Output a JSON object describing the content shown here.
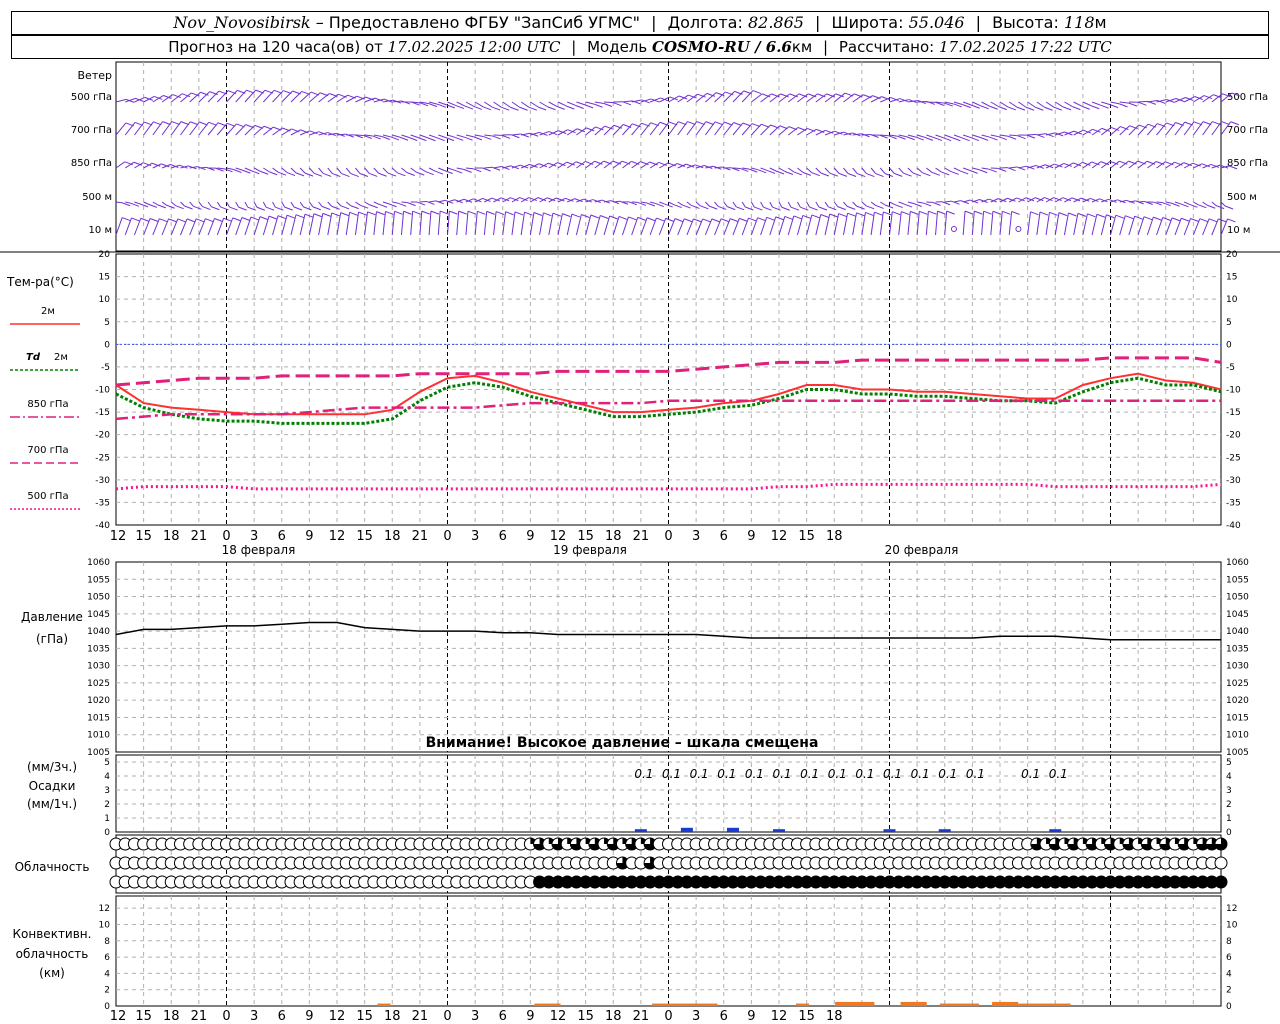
{
  "header": {
    "station": "Nov_Novosibirsk",
    "provider": "– Предоставлено ФГБУ \"ЗапСиб УГМС\"",
    "lon_label": "Долгота:",
    "lon": "82.865",
    "lat_label": "Широта:",
    "lat": "55.046",
    "alt_label": "Высота:",
    "alt": "118",
    "alt_unit": "м",
    "forecast_label": "Прогноз на 120 часа(ов) от",
    "forecast_from": "17.02.2025 12:00 UTC",
    "model_label": "Модель",
    "model": "COSMO-RU / 6.6",
    "model_unit": "км",
    "calc_label": "Рассчитано:",
    "calc_time": "17.02.2025 17:22 UTC"
  },
  "colors": {
    "wind": "#7030d0",
    "t2m": "#ff3030",
    "td2m": "#008000",
    "t850": "#e0207a",
    "t700": "#e0207a",
    "t500": "#ff1090",
    "zero_line": "#3050ff",
    "precip": "#1a3ad0",
    "convective": "#f07820",
    "grid": "#b0b0b0"
  },
  "chart_data": [
    {
      "type": "wind_barbs",
      "title": "Ветер",
      "levels": [
        "500 гПа",
        "700 гПа",
        "850 гПа",
        "500 м",
        "10 м"
      ],
      "note": "wind barbs every hour at five levels"
    },
    {
      "type": "line",
      "title": "Тем-ра(°C)",
      "ylim": [
        -40,
        20
      ],
      "yticks": [
        20,
        15,
        10,
        5,
        0,
        -5,
        -10,
        -15,
        -20,
        -25,
        -30,
        -35,
        -40
      ],
      "x_ticks": [
        "12",
        "15",
        "18",
        "21",
        "0",
        "3",
        "6",
        "9",
        "12",
        "15",
        "18",
        "21",
        "0",
        "3",
        "6",
        "9",
        "12",
        "15",
        "18",
        "21",
        "0",
        "3",
        "6",
        "9",
        "12",
        "15",
        "18"
      ],
      "day_labels": [
        "18 февраля",
        "19 февраля",
        "20 февраля"
      ],
      "legend": [
        "2м",
        "Td 2м",
        "850 гПа",
        "700 гПа",
        "500 гПа"
      ],
      "legend_td": "Td",
      "legend_td_level": "2м",
      "x_hours": [
        0,
        3,
        6,
        9,
        12,
        15,
        18,
        21,
        24,
        27,
        30,
        33,
        36,
        39,
        42,
        45,
        48,
        51,
        54,
        57,
        60,
        63,
        66,
        69,
        72,
        75,
        78,
        81,
        84,
        87,
        90,
        93,
        96,
        99,
        102,
        105,
        108,
        111,
        114,
        117,
        120
      ],
      "series": [
        {
          "name": "2м",
          "values": [
            -9,
            -13,
            -14,
            -14.5,
            -15,
            -15.5,
            -15.5,
            -15.5,
            -15.5,
            -15.5,
            -14.5,
            -10.5,
            -7.5,
            -7,
            -8.5,
            -10.5,
            -12,
            -13.5,
            -15,
            -15,
            -14.5,
            -14,
            -13,
            -12.5,
            -11,
            -9,
            -9,
            -10,
            -10,
            -10.5,
            -10.5,
            -11,
            -11.5,
            -12,
            -12,
            -9,
            -7.5,
            -6.5,
            -8,
            -8.5,
            -10
          ]
        },
        {
          "name": "Td 2м",
          "values": [
            -11,
            -14,
            -15.5,
            -16.5,
            -17,
            -17,
            -17.5,
            -17.5,
            -17.5,
            -17.5,
            -16.5,
            -12.5,
            -9.5,
            -8.5,
            -9.5,
            -11.5,
            -13,
            -14.5,
            -16,
            -16,
            -15.5,
            -15,
            -14,
            -13.5,
            -12,
            -10,
            -10,
            -11,
            -11,
            -11.5,
            -11.5,
            -12,
            -12.5,
            -12.5,
            -13,
            -10.5,
            -8.5,
            -7.5,
            -9,
            -9,
            -10.5
          ]
        },
        {
          "name": "850 гПа",
          "values": [
            -16.5,
            -16,
            -15.5,
            -15.5,
            -15.5,
            -15.5,
            -15.5,
            -15,
            -14.5,
            -14,
            -14,
            -14,
            -14,
            -14,
            -13.5,
            -13,
            -13,
            -13,
            -13,
            -13,
            -12.5,
            -12.5,
            -12.5,
            -12.5,
            -12.5,
            -12.5,
            -12.5,
            -12.5,
            -12.5,
            -12.5,
            -12.5,
            -12.5,
            -12.5,
            -12.5,
            -12.5,
            -12.5,
            -12.5,
            -12.5,
            -12.5,
            -12.5,
            -12.5
          ]
        },
        {
          "name": "700 гПа",
          "values": [
            -9,
            -8.5,
            -8,
            -7.5,
            -7.5,
            -7.5,
            -7,
            -7,
            -7,
            -7,
            -7,
            -6.5,
            -6.5,
            -6.5,
            -6.5,
            -6.5,
            -6,
            -6,
            -6,
            -6,
            -6,
            -5.5,
            -5,
            -4.5,
            -4,
            -4,
            -4,
            -3.5,
            -3.5,
            -3.5,
            -3.5,
            -3.5,
            -3.5,
            -3.5,
            -3.5,
            -3.5,
            -3,
            -3,
            -3,
            -3,
            -4
          ]
        },
        {
          "name": "500 гПа",
          "values": [
            -32,
            -31.5,
            -31.5,
            -31.5,
            -31.5,
            -32,
            -32,
            -32,
            -32,
            -32,
            -32,
            -32,
            -32,
            -32,
            -32,
            -32,
            -32,
            -32,
            -32,
            -32,
            -32,
            -32,
            -32,
            -32,
            -31.5,
            -31.5,
            -31,
            -31,
            -31,
            -31,
            -31,
            -31,
            -31,
            -31,
            -31.5,
            -31.5,
            -31.5,
            -31.5,
            -31.5,
            -31.5,
            -31
          ]
        }
      ]
    },
    {
      "type": "line",
      "title": "Давление",
      "units": "(гПа)",
      "ylim": [
        1005,
        1060
      ],
      "yticks": [
        1060,
        1055,
        1050,
        1045,
        1040,
        1035,
        1030,
        1025,
        1020,
        1015,
        1010,
        1005
      ],
      "note_text": "Внимание! Высокое давление – шкала смещена",
      "series": [
        {
          "name": "Давление",
          "values": [
            1039,
            1040.5,
            1040.5,
            1041,
            1041.5,
            1041.5,
            1042,
            1042.5,
            1042.5,
            1041,
            1040.5,
            1040,
            1040,
            1040,
            1039.5,
            1039.5,
            1039,
            1039,
            1039,
            1039,
            1039,
            1039,
            1038.5,
            1038,
            1038,
            1038,
            1038,
            1038,
            1038,
            1038,
            1038,
            1038,
            1038.5,
            1038.5,
            1038.5,
            1038,
            1037.5,
            1037.5,
            1037.5,
            1037.5,
            1037.5
          ]
        }
      ]
    },
    {
      "type": "bar",
      "title": "Осадки",
      "units_3h": "(мм/3ч.)",
      "units_1h": "(мм/1ч.)",
      "ylim": [
        0,
        5
      ],
      "yticks": [
        5,
        4,
        3,
        2,
        1,
        0
      ],
      "labels": [
        {
          "h": 57,
          "text": "0.1"
        },
        {
          "h": 60,
          "text": "0.1"
        },
        {
          "h": 63,
          "text": "0.1"
        },
        {
          "h": 66,
          "text": "0.1"
        },
        {
          "h": 69,
          "text": "0.1"
        },
        {
          "h": 72,
          "text": "0.1"
        },
        {
          "h": 75,
          "text": "0.1"
        },
        {
          "h": 78,
          "text": "0.1"
        },
        {
          "h": 81,
          "text": "0.1"
        },
        {
          "h": 84,
          "text": "0.1"
        },
        {
          "h": 87,
          "text": "0.1"
        },
        {
          "h": 90,
          "text": "0.1"
        },
        {
          "h": 93,
          "text": "0.1"
        },
        {
          "h": 99,
          "text": "0.1"
        },
        {
          "h": 102,
          "text": "0.1"
        }
      ],
      "bars": [
        {
          "h": 57,
          "value": 0.1
        },
        {
          "h": 62,
          "value": 0.15
        },
        {
          "h": 67,
          "value": 0.15
        },
        {
          "h": 72,
          "value": 0.1
        },
        {
          "h": 84,
          "value": 0.1
        },
        {
          "h": 90,
          "value": 0.1
        },
        {
          "h": 102,
          "value": 0.1
        }
      ]
    },
    {
      "type": "symbols",
      "title": "Облачность",
      "rows": [
        "high",
        "middle",
        "low"
      ],
      "low_overcast_from_hour": 32
    },
    {
      "type": "bar",
      "title": "Конвективн. облачность",
      "units": "(км)",
      "ylim": [
        0,
        13
      ],
      "yticks": [
        12,
        10,
        8,
        6,
        4,
        2,
        0
      ],
      "segments": [
        {
          "from": 20,
          "to": 21,
          "value": 0.3
        },
        {
          "from": 32,
          "to": 34,
          "value": 0.3
        },
        {
          "from": 41,
          "to": 46,
          "value": 0.3
        },
        {
          "from": 52,
          "to": 53,
          "value": 0.3
        },
        {
          "from": 55,
          "to": 58,
          "value": 0.5
        },
        {
          "from": 60,
          "to": 62,
          "value": 0.5
        },
        {
          "from": 63,
          "to": 66,
          "value": 0.3
        },
        {
          "from": 67,
          "to": 69,
          "value": 0.5
        },
        {
          "from": 69,
          "to": 73,
          "value": 0.3
        }
      ]
    }
  ]
}
